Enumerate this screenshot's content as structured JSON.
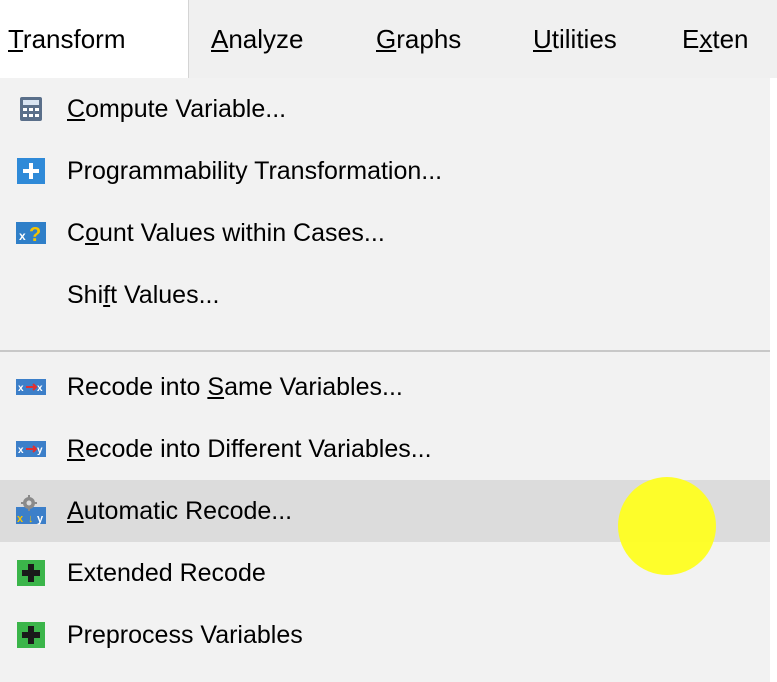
{
  "menubar": {
    "items": [
      {
        "label": "Transform",
        "mnemonic_index": 0
      },
      {
        "label": "Analyze",
        "mnemonic_index": 0
      },
      {
        "label": "Graphs",
        "mnemonic_index": 0
      },
      {
        "label": "Utilities",
        "mnemonic_index": 0
      },
      {
        "label": "Exten",
        "mnemonic_index": 1
      }
    ]
  },
  "transform_menu": {
    "items": [
      {
        "label": "Compute Variable...",
        "mnemonic_index": 0,
        "icon": "calculator-icon"
      },
      {
        "label": "Programmability Transformation...",
        "mnemonic_index": -1,
        "icon": "plus-blue-icon"
      },
      {
        "label": "Count Values within Cases...",
        "mnemonic_index": 1,
        "icon": "count-values-icon"
      },
      {
        "label": "Shift Values...",
        "mnemonic_index": 3,
        "icon": ""
      },
      {
        "label": "Recode into Same Variables...",
        "mnemonic_index": 12,
        "icon": "recode-same-icon"
      },
      {
        "label": "Recode into Different Variables...",
        "mnemonic_index": 0,
        "icon": "recode-different-icon"
      },
      {
        "label": "Automatic Recode...",
        "mnemonic_index": 0,
        "icon": "automatic-recode-icon"
      },
      {
        "label": "Extended Recode",
        "mnemonic_index": -1,
        "icon": "plus-green-icon"
      },
      {
        "label": "Preprocess Variables",
        "mnemonic_index": -1,
        "icon": "plus-green-icon"
      }
    ]
  },
  "colors": {
    "menubar_bg": "#f0f0f0",
    "menu_bg": "#f2f2f2",
    "hover_bg": "#dcdcdc",
    "cursor_highlight": "#ffff1a"
  }
}
